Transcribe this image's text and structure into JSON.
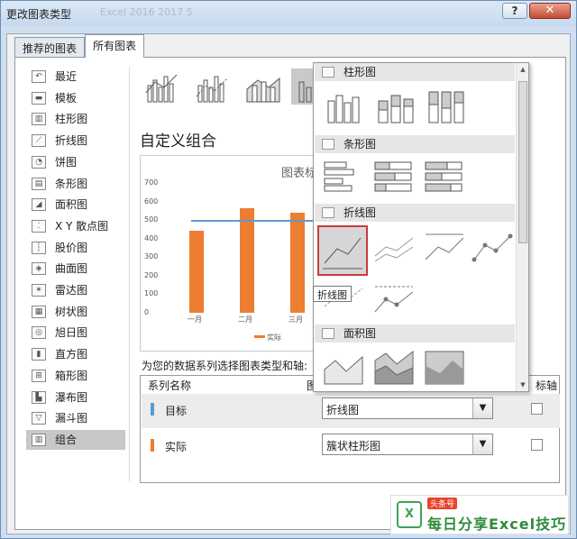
{
  "window": {
    "title": "更改图表类型",
    "title_faded": "Excel 2016 2017 5",
    "help": "?",
    "close": "✕"
  },
  "tabs": [
    {
      "label": "推荐的图表"
    },
    {
      "label": "所有图表"
    }
  ],
  "sidebar": {
    "items": [
      {
        "label": "最近",
        "icon": "recent-icon"
      },
      {
        "label": "模板",
        "icon": "folder-icon"
      },
      {
        "label": "柱形图",
        "icon": "column-chart-icon"
      },
      {
        "label": "折线图",
        "icon": "line-chart-icon"
      },
      {
        "label": "饼图",
        "icon": "pie-chart-icon"
      },
      {
        "label": "条形图",
        "icon": "bar-chart-icon"
      },
      {
        "label": "面积图",
        "icon": "area-chart-icon"
      },
      {
        "label": "X Y 散点图",
        "icon": "scatter-chart-icon"
      },
      {
        "label": "股价图",
        "icon": "stock-chart-icon"
      },
      {
        "label": "曲面图",
        "icon": "surface-chart-icon"
      },
      {
        "label": "雷达图",
        "icon": "radar-chart-icon"
      },
      {
        "label": "树状图",
        "icon": "treemap-chart-icon"
      },
      {
        "label": "旭日图",
        "icon": "sunburst-chart-icon"
      },
      {
        "label": "直方图",
        "icon": "histogram-chart-icon"
      },
      {
        "label": "箱形图",
        "icon": "box-chart-icon"
      },
      {
        "label": "瀑布图",
        "icon": "waterfall-chart-icon"
      },
      {
        "label": "漏斗图",
        "icon": "funnel-chart-icon"
      },
      {
        "label": "组合",
        "icon": "combo-chart-icon",
        "selected": true
      }
    ]
  },
  "main": {
    "heading": "自定义组合",
    "series_prompt": "为您的数据系列选择图表类型和轴:"
  },
  "chart_data": {
    "type": "bar",
    "title": "图表标",
    "categories": [
      "一月",
      "二月",
      "三月"
    ],
    "series": [
      {
        "name": "实际",
        "values": [
          440,
          565,
          540
        ]
      }
    ],
    "target_value": 500,
    "ylim": [
      0,
      700
    ],
    "yticks": [
      "700",
      "600",
      "500",
      "400",
      "300",
      "200",
      "100",
      "0"
    ],
    "legend": "实际"
  },
  "table": {
    "headers": {
      "name": "系列名称",
      "type": "图表",
      "axis": "标轴"
    },
    "rows": [
      {
        "name": "目标",
        "color": "#5b9bd5",
        "type": "折线图"
      },
      {
        "name": "实际",
        "color": "#ed7d31",
        "type": "簇状柱形图"
      }
    ]
  },
  "gallery": {
    "sections": [
      {
        "label": "柱形图"
      },
      {
        "label": "条形图"
      },
      {
        "label": "折线图"
      },
      {
        "label": "面积图"
      }
    ],
    "tooltip": "折线图"
  },
  "watermark": {
    "badge": "头条号",
    "text": "每日分享Excel技巧",
    "logo": "X"
  }
}
